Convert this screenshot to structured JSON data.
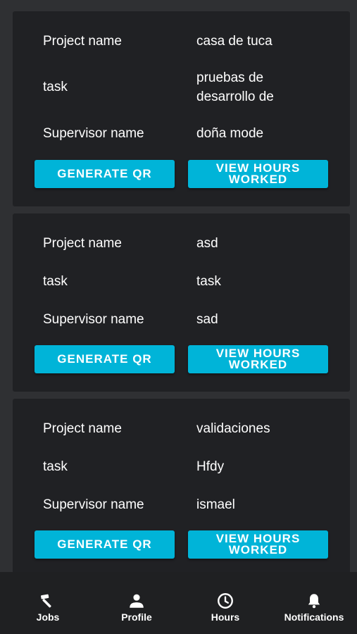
{
  "jobs": [
    {
      "project_label": "Project name",
      "project_value": "casa de tuca",
      "task_label": "task",
      "task_value": "pruebas de desarrollo de",
      "supervisor_label": "Supervisor name",
      "supervisor_value": "doña mode",
      "qr_button": "GENERATE QR",
      "hours_button": "VIEW HOURS\nWORKED"
    },
    {
      "project_label": "Project name",
      "project_value": "asd",
      "task_label": "task",
      "task_value": "task",
      "supervisor_label": "Supervisor name",
      "supervisor_value": "sad",
      "qr_button": "GENERATE QR",
      "hours_button": "VIEW HOURS\nWORKED"
    },
    {
      "project_label": "Project name",
      "project_value": "validaciones",
      "task_label": "task",
      "task_value": "Hfdy",
      "supervisor_label": "Supervisor name",
      "supervisor_value": "ismael",
      "qr_button": "GENERATE QR",
      "hours_button": "VIEW HOURS\nWORKED"
    }
  ],
  "nav": {
    "items": [
      {
        "label": "Jobs",
        "icon": "hammer-icon"
      },
      {
        "label": "Profile",
        "icon": "person-icon"
      },
      {
        "label": "Hours",
        "icon": "clock-icon"
      },
      {
        "label": "Notifications",
        "icon": "bell-icon"
      }
    ]
  },
  "colors": {
    "background": "#2f3033",
    "card": "#202124",
    "accent": "#00b4d8",
    "nav_bar": "#1f2022"
  }
}
